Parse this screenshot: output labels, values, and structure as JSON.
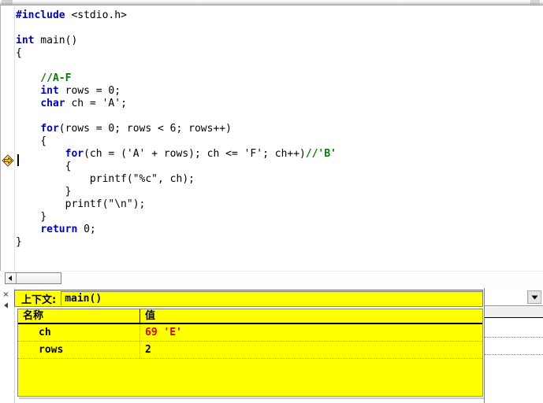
{
  "window": {
    "title": "C debugger - source editor with watch window"
  },
  "editor": {
    "gutter": {
      "exec_marker_icon": "yellow-right-arrow-icon",
      "exec_marker_line": 12
    },
    "lines": [
      {
        "indent": 0,
        "tokens": [
          {
            "t": "pp",
            "s": "#include"
          },
          {
            "t": "plain",
            "s": " <stdio.h>"
          }
        ]
      },
      {
        "indent": 0,
        "tokens": []
      },
      {
        "indent": 0,
        "tokens": [
          {
            "t": "kw",
            "s": "int"
          },
          {
            "t": "plain",
            "s": " main()"
          }
        ]
      },
      {
        "indent": 0,
        "tokens": [
          {
            "t": "plain",
            "s": "{"
          }
        ]
      },
      {
        "indent": 0,
        "tokens": []
      },
      {
        "indent": 0,
        "tokens": [
          {
            "t": "cmt",
            "s": "    //A-F"
          }
        ]
      },
      {
        "indent": 0,
        "tokens": [
          {
            "t": "plain",
            "s": "    "
          },
          {
            "t": "kw",
            "s": "int"
          },
          {
            "t": "plain",
            "s": " rows = 0;"
          }
        ]
      },
      {
        "indent": 0,
        "tokens": [
          {
            "t": "plain",
            "s": "    "
          },
          {
            "t": "kw",
            "s": "char"
          },
          {
            "t": "plain",
            "s": " ch = 'A';"
          }
        ]
      },
      {
        "indent": 0,
        "tokens": []
      },
      {
        "indent": 0,
        "tokens": [
          {
            "t": "plain",
            "s": "    "
          },
          {
            "t": "kw",
            "s": "for"
          },
          {
            "t": "plain",
            "s": "(rows = 0; rows < 6; rows++)"
          }
        ]
      },
      {
        "indent": 0,
        "tokens": [
          {
            "t": "plain",
            "s": "    {"
          }
        ]
      },
      {
        "indent": 0,
        "tokens": [
          {
            "t": "plain",
            "s": "        "
          },
          {
            "t": "kw",
            "s": "for"
          },
          {
            "t": "plain",
            "s": "(ch = ('A' + rows); ch <= 'F'; ch++)"
          },
          {
            "t": "cmt",
            "s": "//'B'"
          }
        ]
      },
      {
        "indent": 0,
        "tokens": [
          {
            "t": "plain",
            "s": "        {"
          }
        ]
      },
      {
        "indent": 0,
        "tokens": [
          {
            "t": "plain",
            "s": "            printf(\"%c\", ch);"
          }
        ]
      },
      {
        "indent": 0,
        "tokens": [
          {
            "t": "plain",
            "s": "        }"
          }
        ]
      },
      {
        "indent": 0,
        "tokens": [
          {
            "t": "plain",
            "s": "        printf(\"\\n\");"
          }
        ]
      },
      {
        "indent": 0,
        "tokens": [
          {
            "t": "plain",
            "s": "    }"
          }
        ]
      },
      {
        "indent": 0,
        "tokens": [
          {
            "t": "plain",
            "s": "    "
          },
          {
            "t": "kw",
            "s": "return"
          },
          {
            "t": "plain",
            "s": " 0;"
          }
        ]
      },
      {
        "indent": 0,
        "tokens": [
          {
            "t": "plain",
            "s": "}"
          }
        ]
      }
    ],
    "scrollbar": {
      "left_arrow_icon": "triangle-left-icon"
    }
  },
  "debug_panel": {
    "close_icon_label": "×",
    "collapse_icon": "triangle-left-icon",
    "context_label": "上下文:",
    "context_value": "main()",
    "dropdown_icon": "chevron-down-icon",
    "columns": [
      "名称",
      "值"
    ],
    "rows": [
      {
        "name": "ch",
        "value": "69  'E'",
        "changed": true
      },
      {
        "name": "rows",
        "value": "2",
        "changed": false
      }
    ]
  },
  "colors": {
    "keyword": "#0000c0",
    "comment": "#008000",
    "watch_bg": "#ffff00",
    "changed_value": "#cc0000",
    "exec_arrow": "#ffcc00"
  }
}
